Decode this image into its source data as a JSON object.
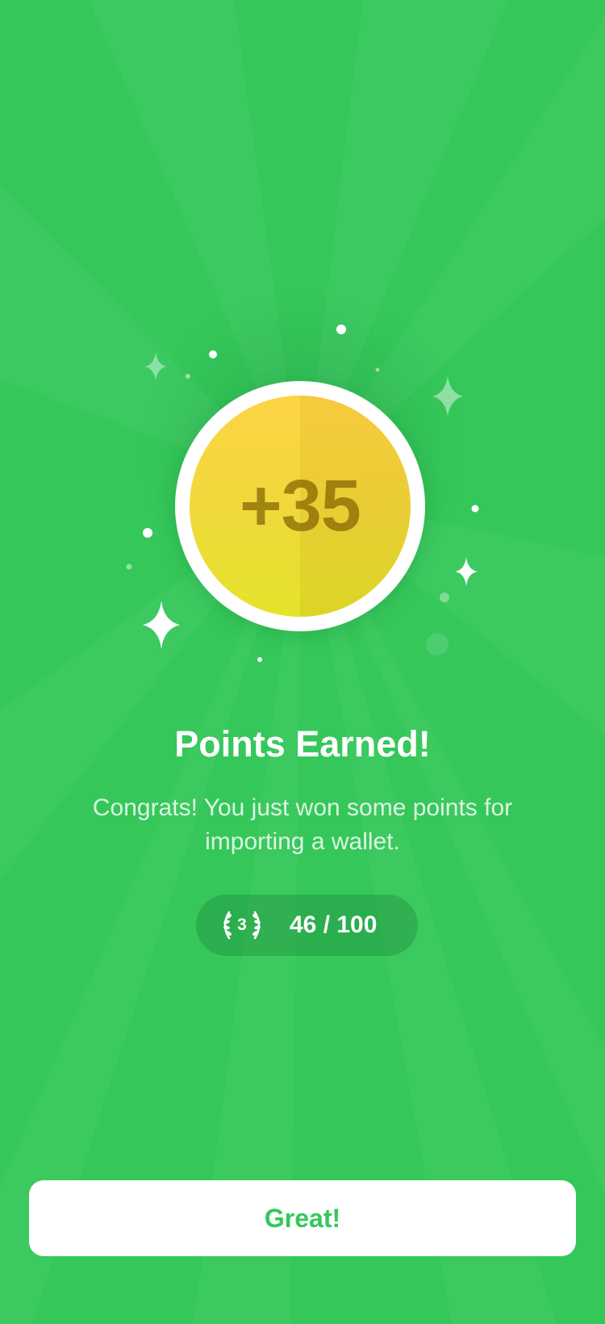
{
  "reward": {
    "points_label": "+35"
  },
  "title": "Points Earned!",
  "message": "Congrats! You just won some points for importing a wallet.",
  "progress": {
    "level": "3",
    "text": "46 / 100",
    "current": 46,
    "total": 100
  },
  "primary_button": {
    "label": "Great!"
  },
  "colors": {
    "background": "#35c75a",
    "coin": "#efd93a",
    "button_text": "#35c75a"
  },
  "icons": {
    "badge": "laurel-wreath-icon",
    "sparkle": "sparkle-star-icon"
  }
}
